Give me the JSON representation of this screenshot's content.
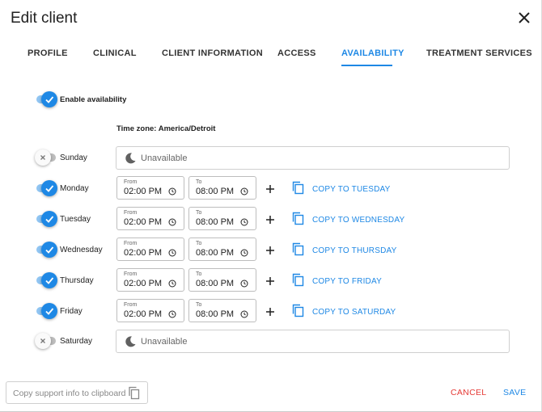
{
  "dialog": {
    "title": "Edit client"
  },
  "tabs": [
    {
      "label": "PROFILE"
    },
    {
      "label": "CLINICAL"
    },
    {
      "label": "CLIENT INFORMATION"
    },
    {
      "label": "ACCESS"
    },
    {
      "label": "AVAILABILITY"
    },
    {
      "label": "TREATMENT SERVICES"
    }
  ],
  "active_tab": "AVAILABILITY",
  "availability": {
    "enable_label": "Enable availability",
    "enabled": true,
    "timezone": "Time zone: America/Detroit",
    "from_caption": "From",
    "to_caption": "To",
    "unavailable_text": "Unavailable",
    "days": [
      {
        "name": "Sunday",
        "enabled": false
      },
      {
        "name": "Monday",
        "enabled": true,
        "from": "02:00 PM",
        "to": "08:00 PM",
        "copy_label": "COPY TO TUESDAY"
      },
      {
        "name": "Tuesday",
        "enabled": true,
        "from": "02:00 PM",
        "to": "08:00 PM",
        "copy_label": "COPY TO WEDNESDAY"
      },
      {
        "name": "Wednesday",
        "enabled": true,
        "from": "02:00 PM",
        "to": "08:00 PM",
        "copy_label": "COPY TO THURSDAY"
      },
      {
        "name": "Thursday",
        "enabled": true,
        "from": "02:00 PM",
        "to": "08:00 PM",
        "copy_label": "COPY TO FRIDAY"
      },
      {
        "name": "Friday",
        "enabled": true,
        "from": "02:00 PM",
        "to": "08:00 PM",
        "copy_label": "COPY TO SATURDAY"
      },
      {
        "name": "Saturday",
        "enabled": false
      }
    ]
  },
  "footer": {
    "support_label": "Copy support info to clipboard",
    "cancel_label": "CANCEL",
    "save_label": "SAVE"
  },
  "colors": {
    "accent": "#1e88e5",
    "danger": "#e53935"
  },
  "icons": [
    "close-icon",
    "check-icon",
    "x-icon",
    "moon-icon",
    "clock-icon",
    "plus-icon",
    "copy-icon"
  ]
}
